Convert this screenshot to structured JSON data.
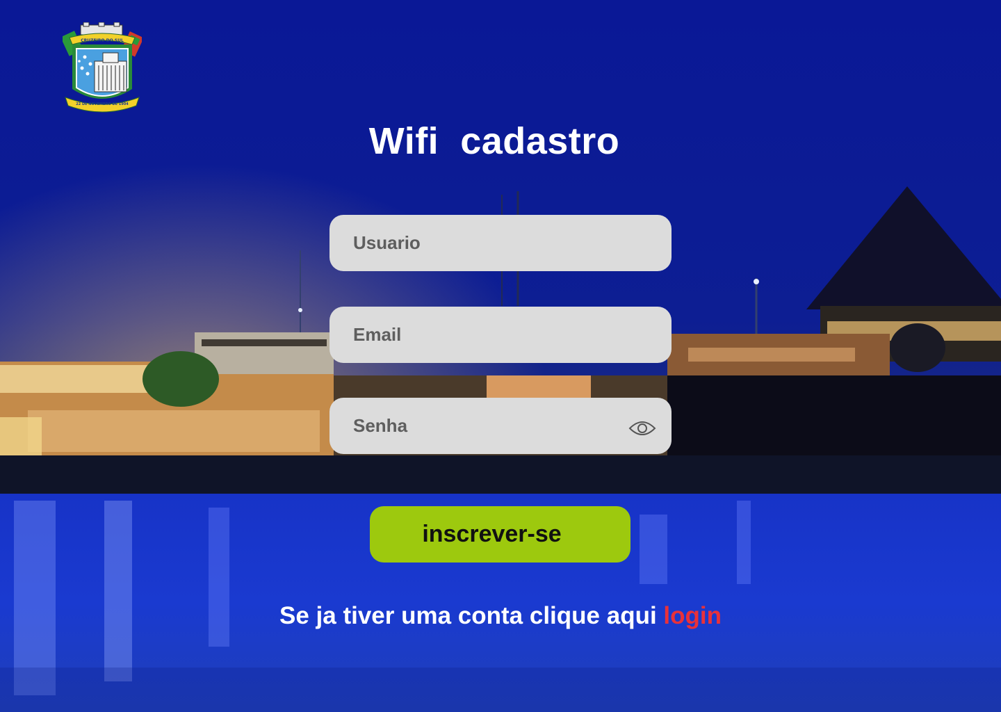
{
  "page": {
    "title": "Wifi  cadastro"
  },
  "logo": {
    "banner_text": "CRUZEIRO DO SUL",
    "date_ribbon": "22 DE NOVEMBRO DE 1904"
  },
  "form": {
    "username": {
      "placeholder": "Usuario",
      "value": ""
    },
    "email": {
      "placeholder": "Email",
      "value": ""
    },
    "password": {
      "placeholder": "Senha",
      "value": "",
      "toggle_icon": "eye-icon"
    }
  },
  "submit": {
    "label": "inscrever-se"
  },
  "footer": {
    "prompt": "Se ja tiver uma conta clique aqui ",
    "link_label": "login"
  },
  "colors": {
    "button": "#9dc90e",
    "field": "#dcdcdc",
    "link": "#e8313a",
    "text": "#ffffff"
  }
}
